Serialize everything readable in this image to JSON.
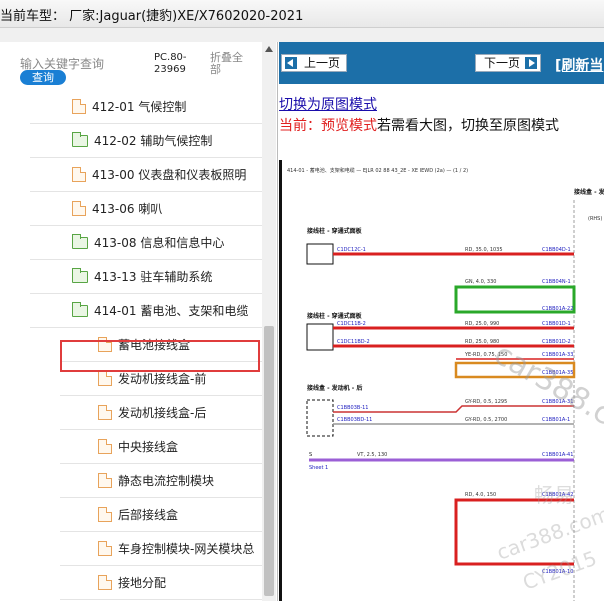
{
  "window": {
    "title": "当前车型： 厂家:Jaguar(捷豹)XE/X7602020-2021"
  },
  "sidebar": {
    "search_hint": "输入关键字查询",
    "query_button": "查询",
    "pc_label": "PC.80-23969",
    "collapse_all": "折叠全部",
    "tree": [
      {
        "label": "412-01 气候控制",
        "icon": "document-icon",
        "level": 1
      },
      {
        "label": "412-02 辅助气候控制",
        "icon": "folder-icon",
        "level": 1
      },
      {
        "label": "413-00 仪表盘和仪表板照明",
        "icon": "document-icon",
        "level": 1
      },
      {
        "label": "413-06 喇叭",
        "icon": "document-icon",
        "level": 1
      },
      {
        "label": "413-08 信息和信息中心",
        "icon": "folder-icon",
        "level": 1
      },
      {
        "label": "413-13 驻车辅助系统",
        "icon": "folder-icon",
        "level": 1
      },
      {
        "label": "414-01 蓄电池、支架和电缆",
        "icon": "folder-open-icon",
        "level": 1,
        "selected": true
      },
      {
        "label": "蓄电池接线盒",
        "icon": "document-icon",
        "level": 2
      },
      {
        "label": "发动机接线盒-前",
        "icon": "document-icon",
        "level": 2
      },
      {
        "label": "发动机接线盒-后",
        "icon": "document-icon",
        "level": 2
      },
      {
        "label": "中央接线盒",
        "icon": "document-icon",
        "level": 2
      },
      {
        "label": "静态电流控制模块",
        "icon": "document-icon",
        "level": 2
      },
      {
        "label": "后部接线盒",
        "icon": "document-icon",
        "level": 2
      },
      {
        "label": "车身控制模块-网关模块总",
        "icon": "document-icon",
        "level": 2
      },
      {
        "label": "接地分配",
        "icon": "document-icon",
        "level": 2
      }
    ]
  },
  "viewer": {
    "prev_button": "上一页",
    "next_button": "下一页",
    "refresh_link": "[刷新当",
    "switch_link": "切换为原图模式",
    "current_prefix": "当前：预览模式",
    "current_suffix": "若需看大图，切换至原图模式",
    "diagram": {
      "header": "414-01 - 蓄电池、支架和电缆 — EJLR 02 88 43_2E - XE IEWD (2a) — (1 / 2)",
      "labels": {
        "junction_front": "接线盒 - 发动机 - 前",
        "rhs": "(RHS)",
        "pass_panel_1": "接线柱 - 穿通式面板",
        "pass_panel_2": "接线柱 - 穿通式面板",
        "junction_rear": "接线盒 - 发动机 - 后",
        "sheet": "Sheet 1",
        "s_marker": "S"
      },
      "connectors": [
        "C1DC12C-1",
        "C1BB04D-1",
        "C1BB04N-1",
        "C1BB01A-22",
        "C1DC11B-2",
        "C1BB01D-1",
        "C1DC11BD-2",
        "C1BB01D-2",
        "C1BB01A-33",
        "C1BB01A-35",
        "C1BB03B-11",
        "C1BB01A-31",
        "C1BB03BD-11",
        "C1BB01A-1",
        "C1BB01A-41",
        "C1BB01A-42",
        "C1BB01A-10"
      ],
      "wires": [
        "RD, 35.0, 1035",
        "GN, 4.0, 330",
        "RD, 25.0, 990",
        "RD, 25.0, 980",
        "YE-RD, 0.75, 150",
        "GY-RD, 0.5, 1295",
        "GY-RD, 0.5, 2700",
        "VT, 2.5, 130",
        "RD, 4.0, 150"
      ],
      "watermark": [
        "car388.c",
        "畅易",
        "car388.com",
        "CY2015"
      ]
    }
  }
}
